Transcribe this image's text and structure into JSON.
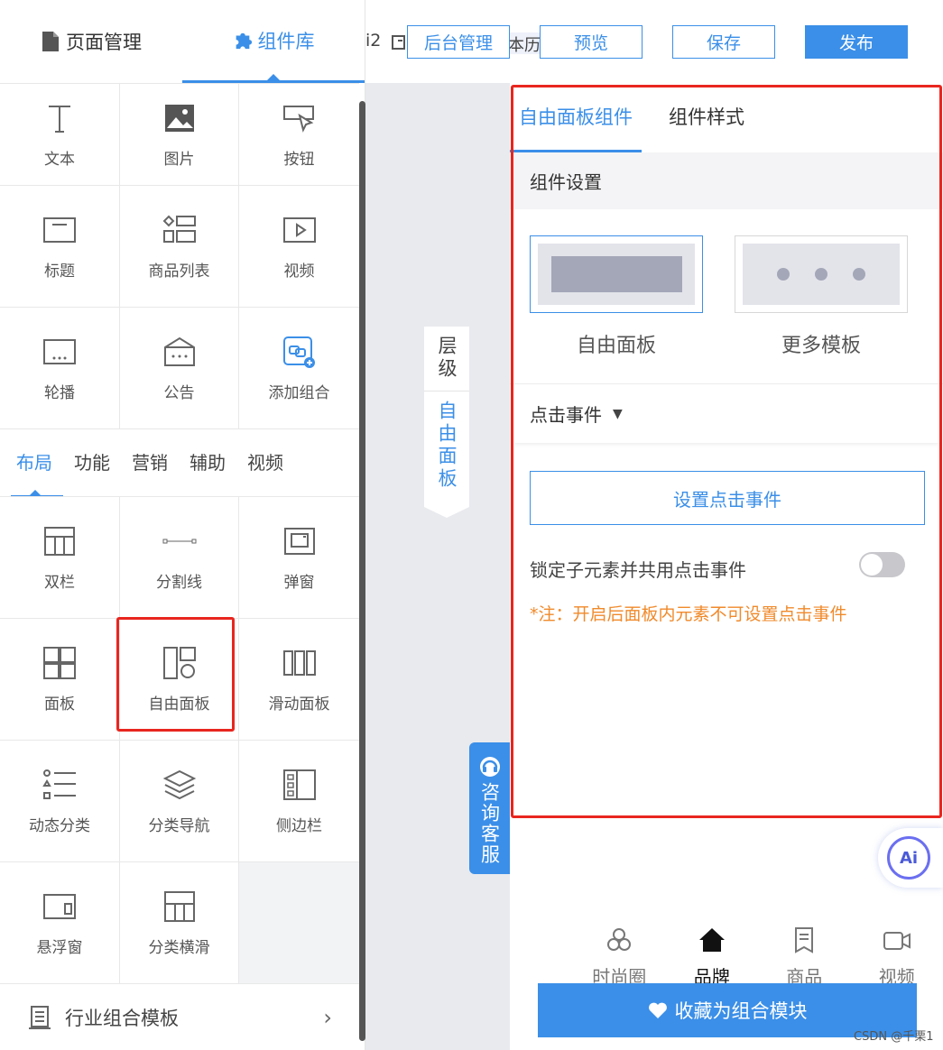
{
  "left_tabs": {
    "page_manage": "页面管理",
    "component_lib": "组件库"
  },
  "basic_components": [
    {
      "label": "文本",
      "icon": "text-icon"
    },
    {
      "label": "图片",
      "icon": "image-icon"
    },
    {
      "label": "按钮",
      "icon": "button-icon"
    },
    {
      "label": "标题",
      "icon": "title-icon"
    },
    {
      "label": "商品列表",
      "icon": "product-list-icon"
    },
    {
      "label": "视频",
      "icon": "video-icon"
    },
    {
      "label": "轮播",
      "icon": "carousel-icon"
    },
    {
      "label": "公告",
      "icon": "notice-icon"
    },
    {
      "label": "添加组合",
      "icon": "add-group-icon"
    }
  ],
  "category_tabs": [
    "布局",
    "功能",
    "营销",
    "辅助",
    "视频"
  ],
  "layout_components": [
    {
      "label": "双栏",
      "icon": "two-column-icon"
    },
    {
      "label": "分割线",
      "icon": "divider-icon"
    },
    {
      "label": "弹窗",
      "icon": "popup-icon"
    },
    {
      "label": "面板",
      "icon": "panel-icon"
    },
    {
      "label": "自由面板",
      "icon": "free-panel-icon"
    },
    {
      "label": "滑动面板",
      "icon": "slide-panel-icon"
    },
    {
      "label": "动态分类",
      "icon": "dynamic-category-icon"
    },
    {
      "label": "分类导航",
      "icon": "category-nav-icon"
    },
    {
      "label": "侧边栏",
      "icon": "sidebar-icon"
    },
    {
      "label": "悬浮窗",
      "icon": "floating-window-icon"
    },
    {
      "label": "分类横滑",
      "icon": "category-scroll-icon"
    }
  ],
  "industry_template": "行业组合模板",
  "topbar": {
    "fragment_left": "i2",
    "fragment_history": "本历史",
    "backend": "后台管理",
    "preview": "预览",
    "save": "保存",
    "publish": "发布"
  },
  "layer_tab": {
    "layer": "层级",
    "current": "自由面板"
  },
  "consult": "咨询客服",
  "panel": {
    "tab_component": "自由面板组件",
    "tab_style": "组件样式",
    "section_title": "组件设置",
    "template_free": "自由面板",
    "template_more": "更多模板",
    "click_event": "点击事件",
    "set_event_button": "设置点击事件",
    "lock_label": "锁定子元素并共用点击事件",
    "note": "*注：开启后面板内元素不可设置点击事件"
  },
  "phone_nav": [
    {
      "label": "时尚圈",
      "icon": "circles-icon"
    },
    {
      "label": "品牌",
      "icon": "home-icon"
    },
    {
      "label": "商品",
      "icon": "document-icon"
    },
    {
      "label": "视频",
      "icon": "camera-icon"
    }
  ],
  "collect_button": "收藏为组合模块",
  "ai_badge": "Ai",
  "watermark": "CSDN @千栗1",
  "colors": {
    "accent": "#3b8fe8",
    "highlight": "#e8261f",
    "note": "#f08a2b"
  }
}
